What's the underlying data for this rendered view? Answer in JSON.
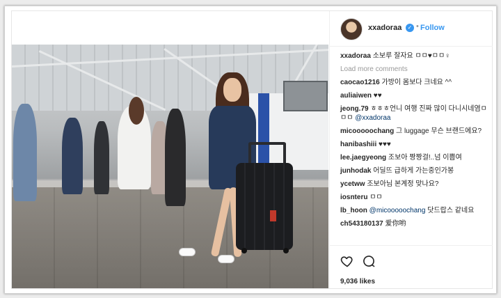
{
  "post": {
    "username": "xxadoraa",
    "verified_icon": "verified-badge-icon",
    "follow_label": "Follow",
    "separator": "•",
    "load_more": "Load more comments",
    "likes": "9,036 likes"
  },
  "caption": {
    "user": "xxadoraa",
    "text": "소보루 잘자요 ㅁㅁ♥ㅁㅁ♀"
  },
  "comments": [
    {
      "user": "caocao1216",
      "text": "가방이 몸보다 크네요 ^^"
    },
    {
      "user": "auliaiwen",
      "text": "♥♥"
    },
    {
      "user": "jeong.79",
      "text": "ㅎㅎㅎ언니 여행 진짜 많이 다니시네염ㅁㅁㅁ ",
      "mention": "@xxadoraa"
    },
    {
      "user": "micooooochang",
      "text": "그 luggage 무슨 브랜드에요?"
    },
    {
      "user": "hanibashiii",
      "text": "♥♥♥"
    },
    {
      "user": "lee.jaegyeong",
      "text": "조보아 짱짱걸!..넘 이쁨여"
    },
    {
      "user": "junhodak",
      "text": "어딜뜨 급하게 가는중인가봉"
    },
    {
      "user": "ycetww",
      "text": "조보아님 본계정 맞나요?"
    },
    {
      "user": "iosnteru",
      "text": "ㅁㅁ"
    },
    {
      "user": "lb_hoon",
      "mention": "@micooooochang",
      "text": " 닷드랍스 같네요"
    },
    {
      "user": "ch543180137",
      "text": "爱你哟"
    }
  ],
  "icons": {
    "like": "heart-icon",
    "comment": "comment-icon",
    "avatar": "avatar"
  },
  "colors": {
    "accent": "#3897f0",
    "mention": "#003569",
    "muted": "#999999"
  }
}
